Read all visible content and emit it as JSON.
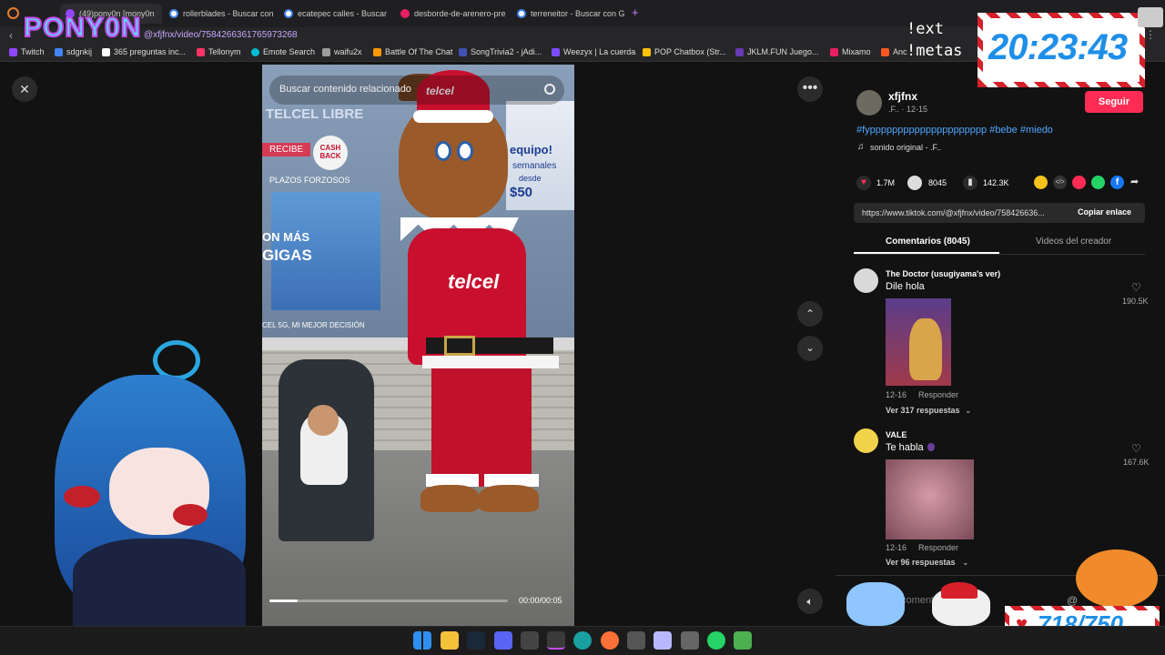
{
  "browser": {
    "tabs": [
      {
        "label": "(49)pony0n [mony0n",
        "color": "#9146ff"
      },
      {
        "label": "rollerblades - Buscar con",
        "color": "#4285f4"
      },
      {
        "label": "ecatepec calles - Buscar",
        "color": "#4285f4"
      },
      {
        "label": "desborde-de-arenero-pre",
        "color": "#e91e63"
      },
      {
        "label": "terreneitor - Buscar con G",
        "color": "#4285f4"
      }
    ],
    "new_tab_symbol": "+",
    "url": "@xfjfnx/video/7584266361765973268",
    "bookmarks": [
      {
        "label": "Twitch",
        "color": "#9146ff"
      },
      {
        "label": "sdgnkij",
        "color": "#4285f4"
      },
      {
        "label": "365 preguntas inc...",
        "color": "#ffffff"
      },
      {
        "label": "Tellonym",
        "color": "#ff3366"
      },
      {
        "label": "Emote Search",
        "color": "#00bcd4"
      },
      {
        "label": "waifu2x",
        "color": "#9e9e9e"
      },
      {
        "label": "Battle Of The Chat",
        "color": "#ff9800"
      },
      {
        "label": "SongTrivia2 - jAdi...",
        "color": "#3f51b5"
      },
      {
        "label": "Weezyx | La cuerda",
        "color": "#7c4dff"
      },
      {
        "label": "POP Chatbox (Str...",
        "color": "#ffc107"
      },
      {
        "label": "JKLM.FUN Juego...",
        "color": "#673ab7"
      },
      {
        "label": "Mixamo",
        "color": "#e91e63"
      },
      {
        "label": "Anc",
        "color": "#ff5722"
      }
    ]
  },
  "overlay": {
    "logo": "PONY0N",
    "command_1": "!ext",
    "command_2": "!metas",
    "clock": "20:23:43",
    "goal": "718/750"
  },
  "video": {
    "search_placeholder": "Buscar contenido relacionado",
    "time": "00:00/00:05",
    "progress": 0.12,
    "store_texts": {
      "telcel_libre": "TELCEL LIBRE",
      "recibe": "RECIBE",
      "cash_back": "CASH BACK",
      "plazos": "PLAZOS FORZOSOS",
      "con_mas": "ON MÁS",
      "gigas": "GIGAS",
      "equipo": "equipo!",
      "semanales": "semanales",
      "desde": "desde",
      "cincuenta": "$50",
      "decision": "CEL 5G, MI MEJOR DECISIÓN",
      "jersey": "telcel",
      "hat_logo": "telcel"
    }
  },
  "post": {
    "username": "xfjfnx",
    "meta": ".F.. · 12-15",
    "follow_label": "Seguir",
    "caption": "#fyppppppppppppppppppppp #bebe #miedo",
    "sound": "sonido original - .F..",
    "likes": "1.7M",
    "comments": "8045",
    "saves": "142.3K",
    "link": "https://www.tiktok.com/@xfjfnx/video/758426636...",
    "copy_label": "Copiar enlace",
    "tab_comments": "Comentarios (8045)",
    "tab_creator": "Videos del creador",
    "comment_input_placeholder": "coment"
  },
  "comments": [
    {
      "author": "The Doctor (usugiyama's ver)",
      "text": "Dile hola",
      "date": "12-16",
      "reply": "Responder",
      "likes": "190.5K",
      "replies": "Ver 317 respuestas"
    },
    {
      "author": "VALE",
      "text": "Te habla",
      "date": "12-16",
      "reply": "Responder",
      "likes": "167.6K",
      "replies": "Ver 96 respuestas"
    }
  ],
  "colors": {
    "accent_pink": "#fe2c55",
    "link_blue": "#4ea6ff",
    "clock_blue": "#1e8fe8",
    "candy_red": "#d6202a"
  }
}
